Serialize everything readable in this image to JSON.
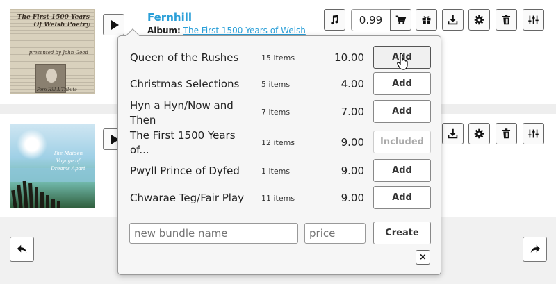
{
  "tracks": [
    {
      "title": "Fernhill",
      "album_label": "Album:",
      "album_name": "The First 1500 Years of Welsh",
      "price": "0.99",
      "cover_text": "The First 1500 Years Of Welsh Poetry",
      "cover_sub": "presented by John Good",
      "cover_sig": "Fern Hill A Tribute"
    },
    {
      "cover_text": "The Maiden Voyage of Dreams Apart"
    }
  ],
  "bundle_popup": {
    "bundles": [
      {
        "name": "Queen of the Rushes",
        "count": "15 items",
        "price": "10.00",
        "action": "Add"
      },
      {
        "name": "Christmas Selections",
        "count": "5 items",
        "price": "4.00",
        "action": "Add"
      },
      {
        "name": "Hyn a Hyn/Now and Then",
        "count": "7 items",
        "price": "7.00",
        "action": "Add"
      },
      {
        "name": "The First 1500 Years of...",
        "count": "12 items",
        "price": "9.00",
        "action": "Included"
      },
      {
        "name": "Pwyll Prince of Dyfed",
        "count": "1 items",
        "price": "9.00",
        "action": "Add"
      },
      {
        "name": "Chwarae Teg/Fair Play",
        "count": "11 items",
        "price": "9.00",
        "action": "Add"
      }
    ],
    "new_name_placeholder": "new bundle name",
    "price_placeholder": "price",
    "create_label": "Create",
    "close_label": "×"
  },
  "icons": {
    "music": "music-note-icon",
    "cart": "cart-icon",
    "gift": "gift-icon",
    "download": "download-icon",
    "settings": "gear-icon",
    "delete": "trash-icon",
    "adjust": "sliders-icon",
    "back": "undo-arrow-icon",
    "forward": "redo-arrow-icon"
  }
}
